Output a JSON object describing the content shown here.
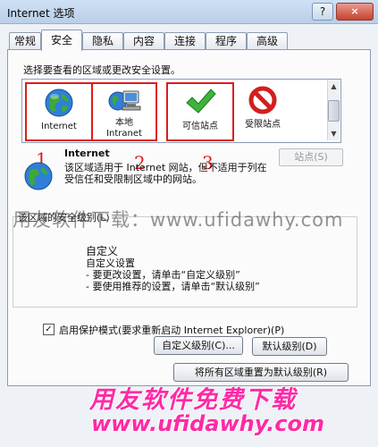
{
  "window": {
    "title": "Internet 选项",
    "help_label": "?",
    "close_label": "×"
  },
  "tabs": [
    "常规",
    "安全",
    "隐私",
    "内容",
    "连接",
    "程序",
    "高级"
  ],
  "active_tab": "安全",
  "zones": {
    "prompt": "选择要查看的区域或更改安全设置。",
    "items": [
      {
        "label": "Internet",
        "icon": "globe-icon"
      },
      {
        "label": "本地\nIntranet",
        "icon": "intranet-icon"
      },
      {
        "label": "可信站点",
        "icon": "check-icon"
      },
      {
        "label": "受限站点",
        "icon": "restricted-icon"
      }
    ],
    "annotations": [
      "1",
      "2",
      "3"
    ]
  },
  "zone_info": {
    "title": "Internet",
    "description": "该区域适用于 Internet 网站，但不适用于列在受信任和受限制区域中的网站。",
    "sites_button": "站点(S)"
  },
  "security_level": {
    "group_label": "该区域的安全级别(L)",
    "custom_title": "自定义",
    "custom_desc": "自定义设置\n- 要更改设置，请单击“自定义级别”\n- 要使用推荐的设置，请单击“默认级别”"
  },
  "protected_mode": {
    "label": "启用保护模式(要求重新启动 Internet Explorer)(P)",
    "checked": true,
    "mark": "✓"
  },
  "buttons": {
    "custom_level": "自定义级别(C)...",
    "default_level": "默认级别(D)",
    "reset_all": "将所有区域重置为默认级别(R)"
  },
  "watermark": {
    "overlay": "用友软件下载：www.ufidawhy.com",
    "title": "用友软件免费下载",
    "url": "www.ufidawhy.com"
  },
  "colors": {
    "highlight": "#e01a1a",
    "watermark_pink": "#ff2aa6"
  }
}
